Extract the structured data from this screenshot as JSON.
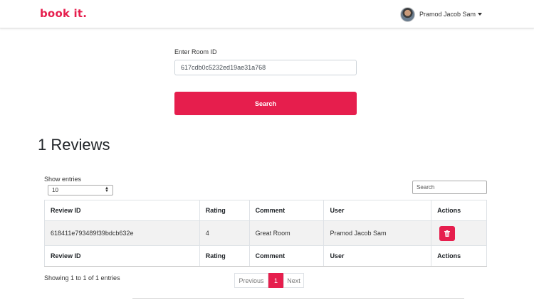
{
  "navbar": {
    "brand": "book it.",
    "user_name": "Pramod Jacob Sam"
  },
  "search_form": {
    "label": "Enter Room ID",
    "room_id_value": "617cdb0c5232ed19ae31a768",
    "button_label": "Search"
  },
  "reviews": {
    "title": "1 Reviews",
    "show_entries_label": "Show entries",
    "entries_selected": "10",
    "search_placeholder": "Search",
    "columns": [
      "Review ID",
      "Rating",
      "Comment",
      "User",
      "Actions"
    ],
    "rows": [
      {
        "review_id": "618411e793489f39bdcb632e",
        "rating": "4",
        "comment": "Great Room",
        "user": "Pramod Jacob Sam"
      }
    ],
    "info": "Showing 1 to 1 of 1 entries",
    "pagination": {
      "previous": "Previous",
      "current": "1",
      "next": "Next"
    }
  },
  "colors": {
    "accent": "#e61e4d"
  },
  "icons": {
    "caret": "caret-down-icon",
    "delete": "trash-icon"
  }
}
